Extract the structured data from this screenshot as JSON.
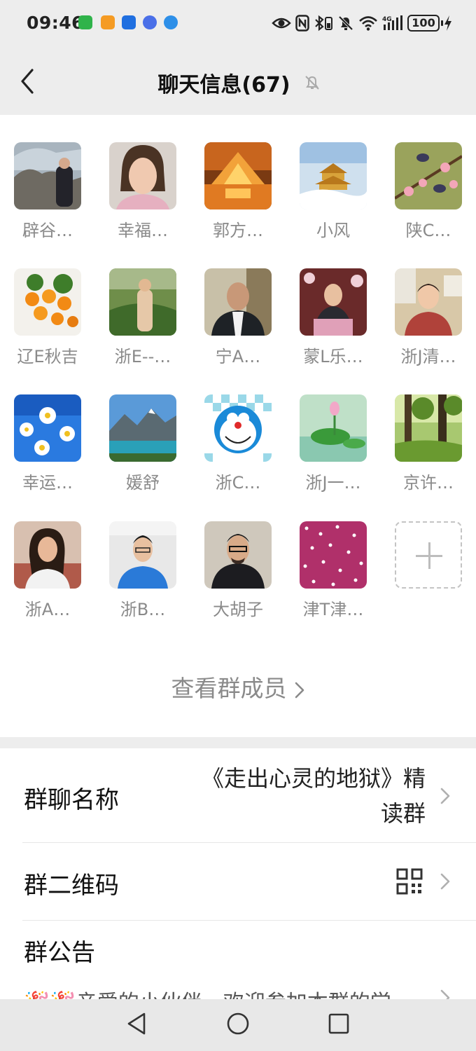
{
  "status_bar": {
    "time": "09:46",
    "battery": "100"
  },
  "nav": {
    "title": "聊天信息(67)"
  },
  "members": [
    {
      "name": "辟谷…"
    },
    {
      "name": "幸福…"
    },
    {
      "name": "郭方…"
    },
    {
      "name": "小风"
    },
    {
      "name": "陕C…"
    },
    {
      "name": "辽E秋吉"
    },
    {
      "name": "浙E--…"
    },
    {
      "name": "宁A…"
    },
    {
      "name": "蒙L乐…"
    },
    {
      "name": "浙J清…"
    },
    {
      "name": "幸运…"
    },
    {
      "name": "媛舒"
    },
    {
      "name": "浙C…"
    },
    {
      "name": "浙J一…"
    },
    {
      "name": "京许…"
    },
    {
      "name": "浙A…"
    },
    {
      "name": "浙B…"
    },
    {
      "name": "大胡子"
    },
    {
      "name": "津T津…"
    }
  ],
  "view_members_label": "查看群成员",
  "settings": {
    "group_name_label": "群聊名称",
    "group_name_line1": "《走出心灵的地狱》精",
    "group_name_line2": "读群",
    "qr_label": "群二维码",
    "notice_label": "群公告",
    "notice_preview": "🎉🎉亲爱的小伙伴，欢迎参加本群的学"
  },
  "colors": {
    "background": "#ededed",
    "secondary_text": "#8a8a8a"
  }
}
